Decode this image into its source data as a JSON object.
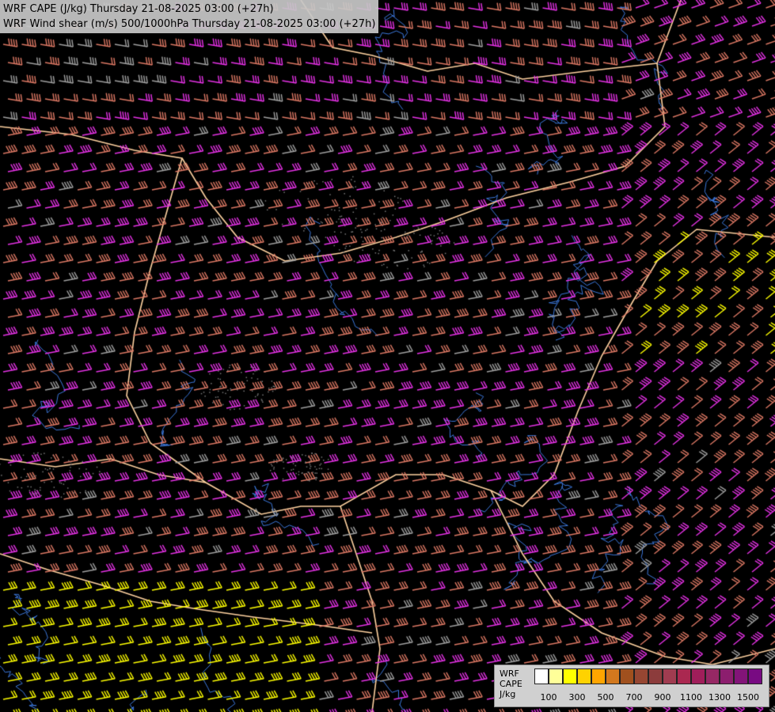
{
  "title": {
    "line1": "WRF CAPE (J/kg) Thursday 21-08-2025 03:00 (+27h)",
    "line2": "WRF Wind shear (m/s) 500/1000hPa Thursday 21-08-2025 03:00 (+27h)"
  },
  "legend": {
    "model": "WRF",
    "field": "CAPE",
    "unit": "J/kg",
    "tick_labels": [
      "100",
      "300",
      "500",
      "700",
      "900",
      "1100",
      "1300",
      "1500"
    ],
    "colors": [
      "#ffffff",
      "#ffff99",
      "#ffff00",
      "#ffd200",
      "#ffa500",
      "#d2781e",
      "#a0501e",
      "#964632",
      "#8c3c3c",
      "#a03c50",
      "#aa2850",
      "#a01e5a",
      "#962864",
      "#8c1e6e",
      "#821478",
      "#780a82"
    ]
  },
  "map_layers": {
    "background": "#000000",
    "borders_color": "#ffd2a0",
    "rivers_color": "#3c78dc",
    "contour_color": "#b4b4b4",
    "barb_colors": {
      "weak": "#a0a0a0",
      "moderate": "#dc7864",
      "strong": "#e632e6",
      "very_strong": "#ffff00",
      "extreme": "#ff78c8"
    },
    "wind_barbs": "wind-shear-barbs",
    "cape_shading": "cape-fill"
  }
}
